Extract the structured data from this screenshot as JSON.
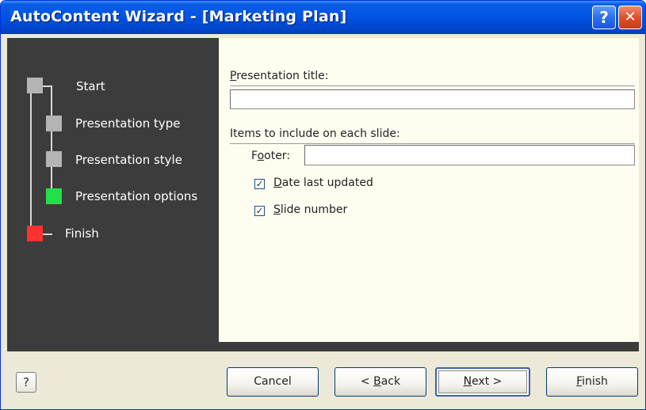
{
  "window": {
    "title": "AutoContent Wizard - [Marketing Plan]",
    "help_glyph": "?",
    "close_glyph": "✕"
  },
  "steps": [
    {
      "label": "Start",
      "state": "visited",
      "color": "#b4b4b4"
    },
    {
      "label": "Presentation type",
      "state": "visited",
      "color": "#b4b4b4"
    },
    {
      "label": "Presentation style",
      "state": "visited",
      "color": "#b4b4b4"
    },
    {
      "label": "Presentation options",
      "state": "current",
      "color": "#22e04a"
    },
    {
      "label": "Finish",
      "state": "end",
      "color": "#ff3030"
    }
  ],
  "form": {
    "presentation_title_label_accel": "P",
    "presentation_title_label_rest": "resentation title:",
    "presentation_title_value": "",
    "items_label": "Items to include on each slide:",
    "footer_label_pre": "F",
    "footer_label_accel": "o",
    "footer_label_rest": "oter:",
    "footer_value": "",
    "date_checkbox_checked": true,
    "date_label_accel": "D",
    "date_label_rest": "ate last updated",
    "slide_checkbox_checked": true,
    "slide_label_accel": "S",
    "slide_label_rest": "lide number",
    "check_glyph": "✓"
  },
  "buttons": {
    "help_icon_glyph": "?",
    "cancel": "Cancel",
    "back_pre": "< ",
    "back_accel": "B",
    "back_rest": "ack",
    "next_accel": "N",
    "next_rest": "ext >",
    "finish_accel": "F",
    "finish_rest": "inish"
  },
  "colors": {
    "titlebar": "#0054e3",
    "panel_dark": "#3c3c3c",
    "panel_light": "#fffdf0",
    "dialog_bg": "#ece9d8"
  }
}
